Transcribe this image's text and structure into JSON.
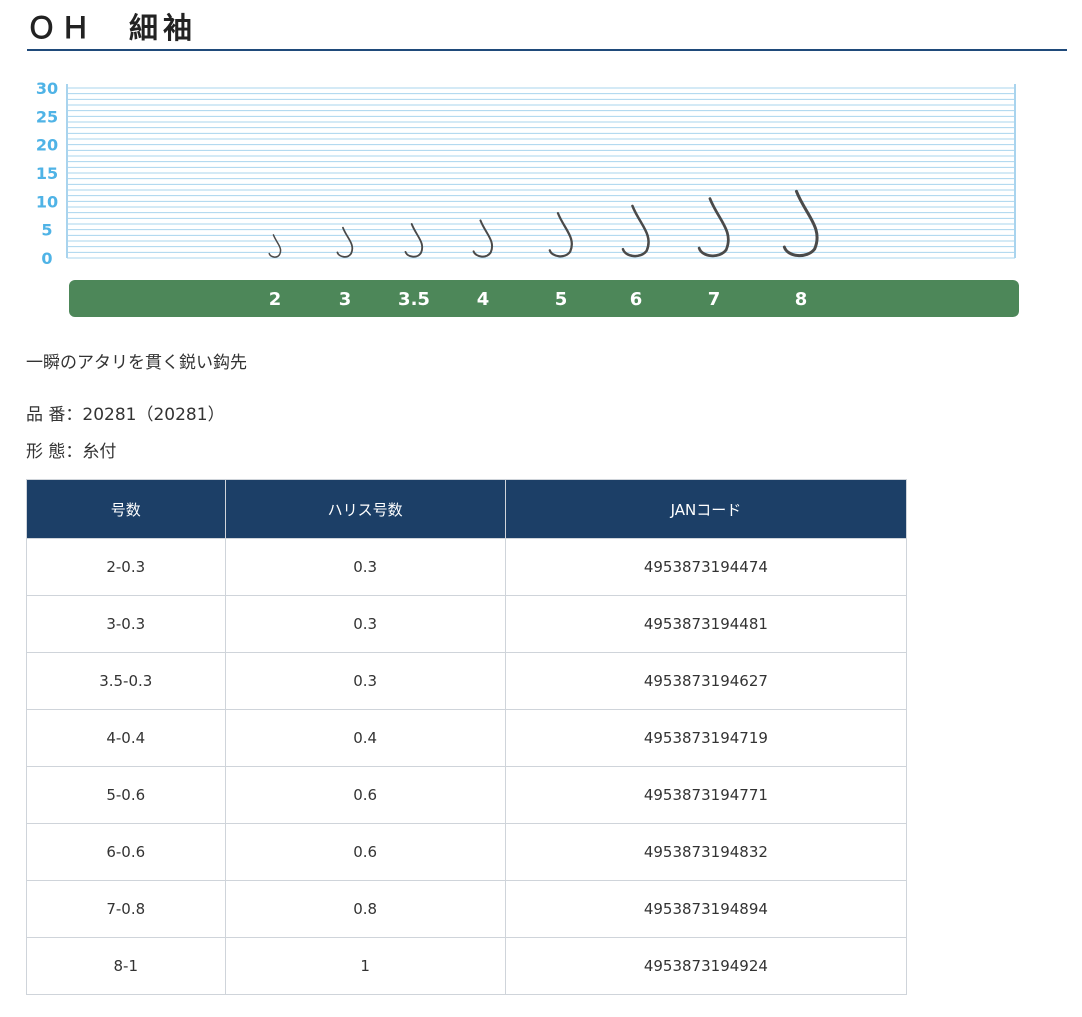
{
  "page": {
    "title": "ＯＨ　細袖",
    "catch_copy": "一瞬のアタリを貫く鋭い鈎先",
    "product_code_label": "品 番：",
    "product_code_value": "20281（20281）",
    "form_label": "形 態：",
    "form_value": "糸付"
  },
  "size_chart": {
    "y_ticks": [
      "30",
      "25",
      "20",
      "15",
      "10",
      "5",
      "0"
    ],
    "hook_sizes": [
      "2",
      "3",
      "3.5",
      "4",
      "5",
      "6",
      "7",
      "8"
    ],
    "colors": {
      "grid": "#a9d4ee",
      "tick_text": "#4fb3e6",
      "band": "#4d8759",
      "band_text": "#ffffff",
      "hook": "#4a4a4a"
    }
  },
  "table": {
    "headers": [
      "号数",
      "ハリス号数",
      "JANコード"
    ],
    "rows": [
      [
        "2-0.3",
        "0.3",
        "4953873194474"
      ],
      [
        "3-0.3",
        "0.3",
        "4953873194481"
      ],
      [
        "3.5-0.3",
        "0.3",
        "4953873194627"
      ],
      [
        "4-0.4",
        "0.4",
        "4953873194719"
      ],
      [
        "5-0.6",
        "0.6",
        "4953873194771"
      ],
      [
        "6-0.6",
        "0.6",
        "4953873194832"
      ],
      [
        "7-0.8",
        "0.8",
        "4953873194894"
      ],
      [
        "8-1",
        "1",
        "4953873194924"
      ]
    ],
    "colors": {
      "header_bg": "#1c3f67",
      "border": "#cfd4da"
    }
  }
}
